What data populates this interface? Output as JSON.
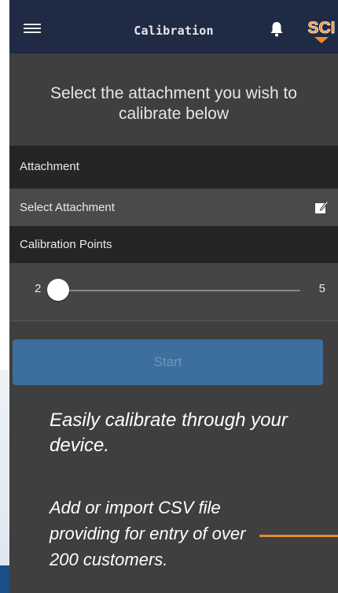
{
  "header": {
    "title": "Calibration",
    "logo_text": "SCI"
  },
  "headline": "Select the attachment you wish to calibrate below",
  "attachment": {
    "section_label": "Attachment",
    "select_label": "Select Attachment"
  },
  "calibration_points": {
    "section_label": "Calibration Points",
    "slider_min": "2",
    "slider_max": "5",
    "slider_value": 2
  },
  "start_button": "Start",
  "promo": {
    "line1": "Easily calibrate through your device.",
    "line2": "Add or import CSV file providing for entry of over 200 customers."
  },
  "colors": {
    "topbar": "#1f2a44",
    "background": "#3f3f3f",
    "button": "#3d6f9e",
    "accent": "#e08a2c"
  },
  "icons": {
    "menu": "hamburger-menu-icon",
    "notifications": "bell-icon",
    "edit": "edit-icon"
  }
}
